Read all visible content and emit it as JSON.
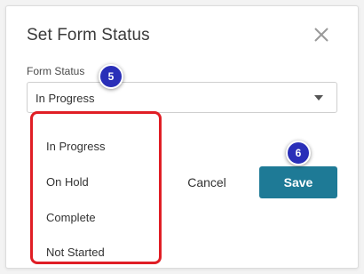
{
  "dialog": {
    "title": "Set Form Status",
    "close_icon": "close-icon"
  },
  "form_status": {
    "label": "Form Status",
    "selected_value": "In Progress",
    "caret_icon": "chevron-down-icon"
  },
  "dropdown": {
    "options": [
      "In Progress",
      "On Hold",
      "Complete",
      "Not Started"
    ],
    "highlight_color": "#e01e25"
  },
  "actions": {
    "cancel_label": "Cancel",
    "save_label": "Save",
    "save_color": "#1e7a96"
  },
  "annotations": {
    "step_5": "5",
    "step_6": "6",
    "badge_color": "#2a2fb8"
  }
}
